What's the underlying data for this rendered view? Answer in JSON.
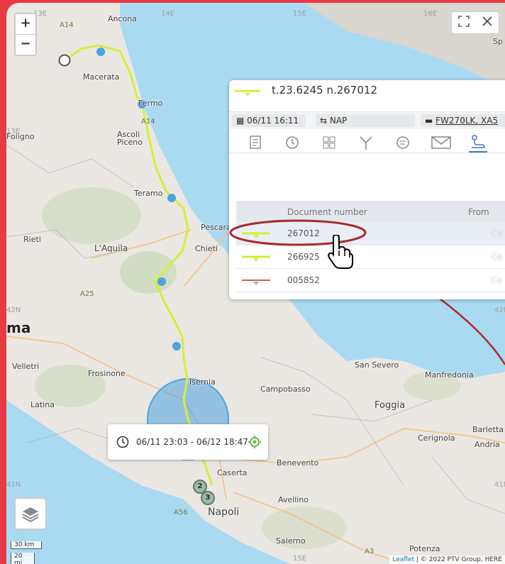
{
  "map": {
    "cities": [
      {
        "name": "Ancona",
        "cls": ""
      },
      {
        "name": "Macerata",
        "cls": ""
      },
      {
        "name": "Fermo",
        "cls": ""
      },
      {
        "name": "Ascoli Piceno",
        "cls": ""
      },
      {
        "name": "Teramo",
        "cls": ""
      },
      {
        "name": "Pescara",
        "cls": ""
      },
      {
        "name": "Chieti",
        "cls": ""
      },
      {
        "name": "L'Aquila",
        "cls": "big"
      },
      {
        "name": "Rieti",
        "cls": ""
      },
      {
        "name": "Frosinone",
        "cls": ""
      },
      {
        "name": "Latina",
        "cls": ""
      },
      {
        "name": "Velletri",
        "cls": ""
      },
      {
        "name": "Isernia",
        "cls": ""
      },
      {
        "name": "Campobasso",
        "cls": ""
      },
      {
        "name": "San Severo",
        "cls": ""
      },
      {
        "name": "Manfredonia",
        "cls": ""
      },
      {
        "name": "Foggia",
        "cls": "big"
      },
      {
        "name": "Barletta",
        "cls": ""
      },
      {
        "name": "Andria",
        "cls": ""
      },
      {
        "name": "Cerignola",
        "cls": ""
      },
      {
        "name": "Benevento",
        "cls": ""
      },
      {
        "name": "Caserta",
        "cls": ""
      },
      {
        "name": "Avellino",
        "cls": ""
      },
      {
        "name": "Napoli",
        "cls": "big"
      },
      {
        "name": "Salerno",
        "cls": ""
      },
      {
        "name": "Potenza",
        "cls": ""
      },
      {
        "name": "ma",
        "cls": "huge"
      },
      {
        "name": "Foligno",
        "cls": ""
      },
      {
        "name": "Sp",
        "cls": ""
      }
    ],
    "grid_labels": [
      "13E",
      "14E",
      "15E",
      "16E",
      "13E",
      "42N",
      "41N",
      "42N",
      "41N",
      "15E"
    ],
    "highways": [
      "A14",
      "A14",
      "A25",
      "A56",
      "A16",
      "A3"
    ],
    "zoom_in": "+",
    "zoom_out": "−",
    "scale_km": "30 km",
    "scale_mi": "20 mi",
    "attribution_link": "Leaflet",
    "attribution_text": "| © 2022 PTV Group, HERE",
    "route_color": "#d4ef38",
    "point_color": "#4ca3e0",
    "badges": [
      "2",
      "3"
    ]
  },
  "panel": {
    "title": "t.23.6245 n.267012",
    "datetime": "06/11 16:11",
    "location": "NAP",
    "vehicle": "FW270LK, XA5",
    "tabs": [
      "documents-icon",
      "history-icon",
      "grid-icon",
      "fork-icon",
      "chat-icon",
      "mail-icon",
      "route-icon"
    ],
    "table": {
      "headers": [
        "Document number",
        "From"
      ],
      "rows": [
        {
          "number": "267012",
          "from": "Ce",
          "color": "#d4ef38",
          "selected": true
        },
        {
          "number": "266925",
          "from": "Ce",
          "color": "#d4ef38",
          "selected": false
        },
        {
          "number": "005852",
          "from": "Ce",
          "color": "#e05a5a",
          "selected": false
        }
      ]
    }
  },
  "time_range": "06/11 23:03 - 06/12 18:47",
  "annotation_color": "#a82a2a"
}
